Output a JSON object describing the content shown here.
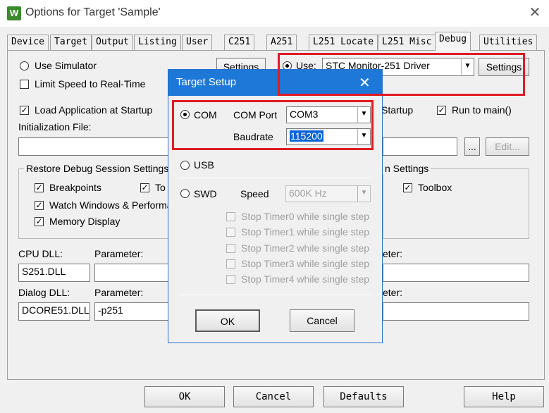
{
  "window": {
    "title": "Options for Target 'Sample'",
    "app_icon": "W",
    "close_glyph": "✕"
  },
  "tabs": [
    {
      "label": "Device"
    },
    {
      "label": "Target"
    },
    {
      "label": "Output"
    },
    {
      "label": "Listing"
    },
    {
      "label": "User"
    },
    {
      "label": "C251"
    },
    {
      "label": "A251"
    },
    {
      "label": "L251 Locate"
    },
    {
      "label": "L251 Misc"
    },
    {
      "label": "Debug"
    },
    {
      "label": "Utilities"
    }
  ],
  "debug": {
    "left": {
      "use_simulator": "Use Simulator",
      "settings": "Settings",
      "limit_speed": "Limit Speed to Real-Time",
      "load_app": "Load Application at Startup",
      "init_file_label": "Initialization File:",
      "restore_group": "Restore Debug Session Settings",
      "breakpoints": "Breakpoints",
      "toolbox_partial": "To",
      "watch_windows": "Watch Windows & Performar",
      "memory_display": "Memory Display",
      "cpu_dll_label": "CPU DLL:",
      "cpu_param_label": "Parameter:",
      "cpu_dll_value": "S251.DLL",
      "dialog_dll_label": "Dialog DLL:",
      "dialog_param_label": "Parameter:",
      "dialog_dll_value": "DCORE51.DLL",
      "dialog_param_value": "-p251"
    },
    "right": {
      "use_label": "Use:",
      "driver_value": "STC Monitor-251 Driver",
      "settings": "Settings",
      "load_startup_partial": "Startup",
      "run_to_main": "Run to main()",
      "browse": "...",
      "edit": "Edit...",
      "restore_group_partial": "n Settings",
      "toolbox": "Toolbox",
      "param_label_partial_1": "eter:",
      "param_label_partial_2": "eter:"
    }
  },
  "target_setup": {
    "title": "Target Setup",
    "close_glyph": "✕",
    "com_label": "COM",
    "com_port_label": "COM Port",
    "com_port_value": "COM3",
    "baudrate_label": "Baudrate",
    "baudrate_value": "115200",
    "usb_label": "USB",
    "swd_label": "SWD",
    "speed_label": "Speed",
    "speed_value": "600K Hz",
    "stop_timers": [
      "Stop Timer0 while single step",
      "Stop Timer1 while single step",
      "Stop Timer2 while single step",
      "Stop Timer3 while single step",
      "Stop Timer4 while single step"
    ],
    "ok": "OK",
    "cancel": "Cancel"
  },
  "footer": {
    "ok": "OK",
    "cancel": "Cancel",
    "defaults": "Defaults",
    "help": "Help"
  },
  "colors": {
    "dialog_title": "#1e78d7",
    "highlight": "#e01b24"
  }
}
